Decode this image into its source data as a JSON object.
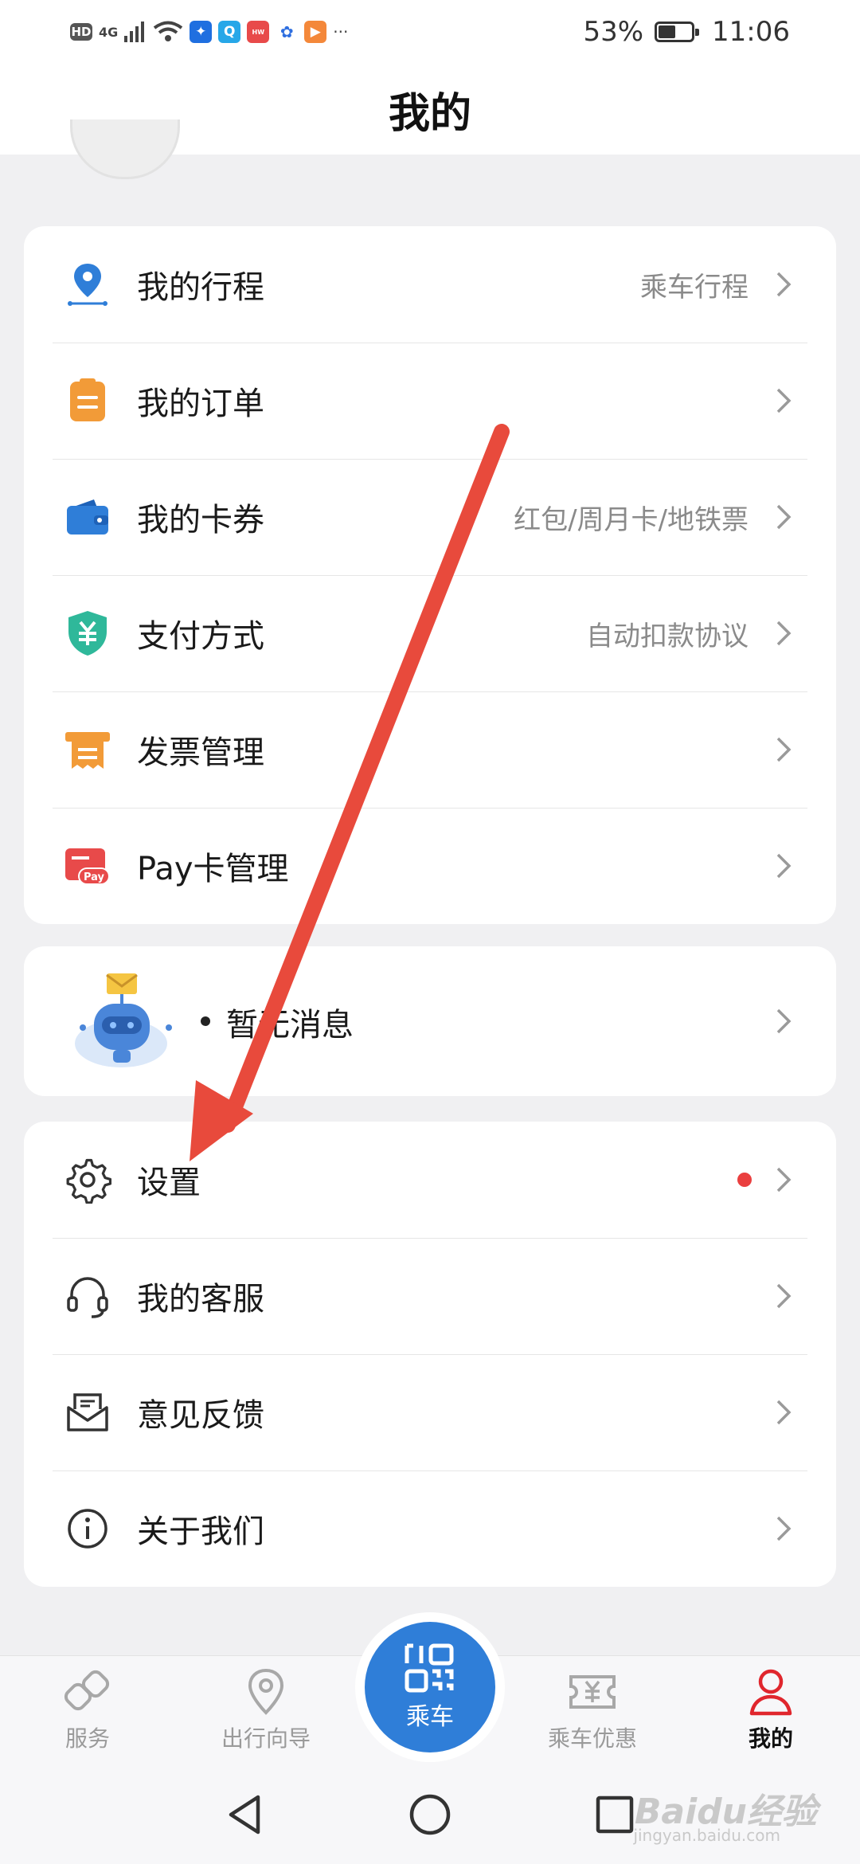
{
  "status_bar": {
    "indicators": [
      "HD",
      "4G"
    ],
    "app_icons": [
      "wifi-icon",
      "bulb-icon",
      "search-app-icon",
      "huawei-icon",
      "baidu-icon",
      "play-icon"
    ],
    "more": "···",
    "battery_percent": "53%",
    "battery_level": 0.53,
    "time": "11:06"
  },
  "header": {
    "title": "我的"
  },
  "menu_main": [
    {
      "label": "我的行程",
      "sub": "乘车行程",
      "icon": "location-pin-icon",
      "color": "#2f7ed8"
    },
    {
      "label": "我的订单",
      "sub": "",
      "icon": "order-clipboard-icon",
      "color": "#f29b38"
    },
    {
      "label": "我的卡券",
      "sub": "红包/周月卡/地铁票",
      "icon": "wallet-icon",
      "color": "#2f7ed8"
    },
    {
      "label": "支付方式",
      "sub": "自动扣款协议",
      "icon": "yuan-shield-icon",
      "color": "#2fb89a"
    },
    {
      "label": "发票管理",
      "sub": "",
      "icon": "invoice-icon",
      "color": "#f29b38"
    },
    {
      "label": "Pay卡管理",
      "sub": "",
      "icon": "pay-card-icon",
      "color": "#e84a4a"
    }
  ],
  "messages": {
    "label": "暂无消息",
    "icon": "robot-mail-icon"
  },
  "menu_settings": [
    {
      "label": "设置",
      "icon": "gear-icon",
      "has_dot": true
    },
    {
      "label": "我的客服",
      "icon": "headset-icon",
      "has_dot": false
    },
    {
      "label": "意见反馈",
      "icon": "feedback-mail-icon",
      "has_dot": false
    },
    {
      "label": "关于我们",
      "icon": "info-icon",
      "has_dot": false
    }
  ],
  "tabbar": {
    "tabs": [
      {
        "label": "服务",
        "icon": "service-icon",
        "active": false
      },
      {
        "label": "出行向导",
        "icon": "guide-pin-icon",
        "active": false
      },
      {
        "label": "乘车",
        "icon": "qr-code-icon",
        "active": false
      },
      {
        "label": "乘车优惠",
        "icon": "coupon-yuan-icon",
        "active": false
      },
      {
        "label": "我的",
        "icon": "user-icon",
        "active": true
      }
    ],
    "active_color": "#e0262d",
    "ride_color": "#2f7ed8"
  },
  "watermark": {
    "brand": "Baidu经验",
    "url": "jingyan.baidu.com"
  }
}
